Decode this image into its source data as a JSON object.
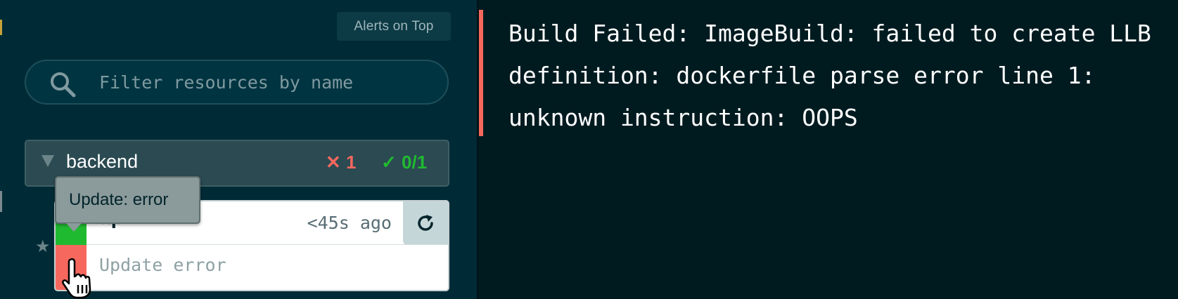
{
  "sidebar": {
    "alerts_button": "Alerts on Top",
    "search": {
      "placeholder": "Filter resources by name",
      "value": ""
    },
    "group": {
      "name": "backend",
      "error_count": "✕ 1",
      "ok_count": "✓ 0/1"
    },
    "resource": {
      "name": "api",
      "time": "<45s ago",
      "update_status": "Update error",
      "starred": false
    },
    "tooltip": "Update: error"
  },
  "log": {
    "lines": [
      "Build Failed: ImageBuild: failed to create LLB",
      "definition: dockerfile parse error line 1:",
      "unknown instruction: OOPS"
    ]
  },
  "icons": {
    "search": "search-icon",
    "caret": "caret-down-icon",
    "star": "star-icon",
    "restart": "restart-icon",
    "cursor": "hand-pointer-icon"
  },
  "colors": {
    "error": "#f6685e",
    "ok": "#20ba31",
    "sidebar_bg": "#002b36",
    "log_bg": "#001b20"
  }
}
